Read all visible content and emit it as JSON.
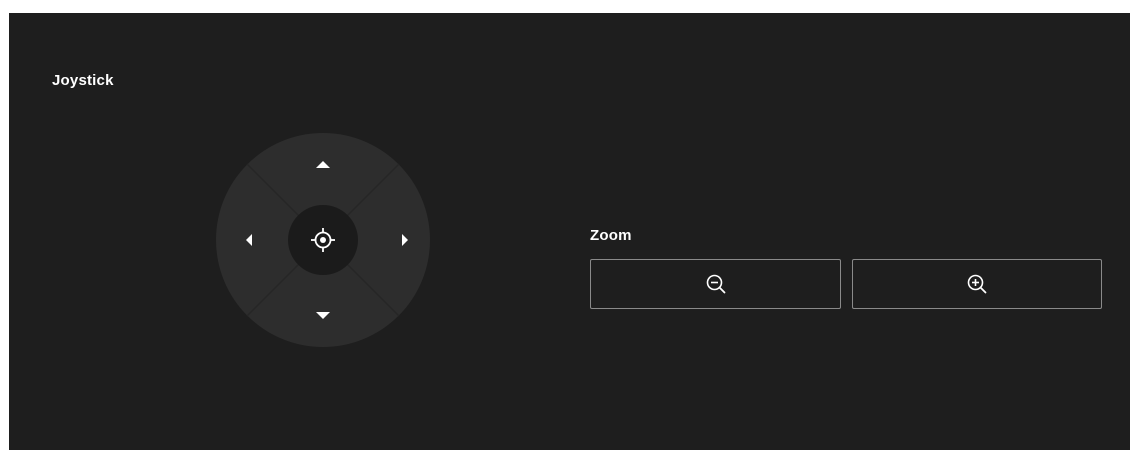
{
  "joystick": {
    "title": "Joystick",
    "up_icon": "triangle-up-icon",
    "down_icon": "triangle-down-icon",
    "left_icon": "triangle-left-icon",
    "right_icon": "triangle-right-icon",
    "center_icon": "crosshair-icon"
  },
  "zoom": {
    "title": "Zoom",
    "zoom_out_icon": "zoom-out-icon",
    "zoom_in_icon": "zoom-in-icon"
  },
  "colors": {
    "panel_background": "#1e1e1e",
    "joystick_ring": "#2d2d2d",
    "joystick_center": "#1b1b1b",
    "button_border": "#8a8a8a",
    "text": "#ffffff"
  }
}
